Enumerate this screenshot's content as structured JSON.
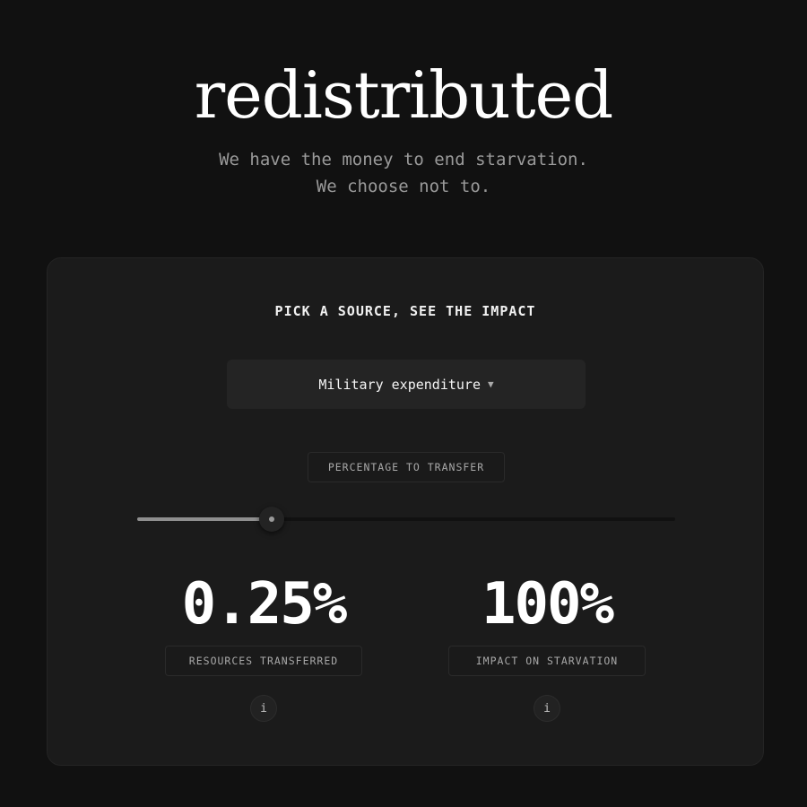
{
  "header": {
    "title": "redistributed",
    "subtitle_line1": "We have the money to end starvation.",
    "subtitle_line2": "We choose not to."
  },
  "card": {
    "heading": "PICK A SOURCE, SEE THE IMPACT",
    "source_select": {
      "selected": "Military expenditure",
      "caret_icon": "chevron-down-icon"
    },
    "percentage_label": "PERCENTAGE TO TRANSFER",
    "slider": {
      "value_fraction": 0.25
    },
    "stats": {
      "resources_value": "0.25%",
      "resources_label": "RESOURCES TRANSFERRED",
      "impact_value": "100%",
      "impact_label": "IMPACT ON STARVATION",
      "info_glyph": "i"
    }
  },
  "colors": {
    "background": "#111111",
    "card": "#1b1b1b",
    "text": "#ffffff",
    "muted": "#9a9a9a",
    "slider_fill": "#8f8f8f"
  }
}
